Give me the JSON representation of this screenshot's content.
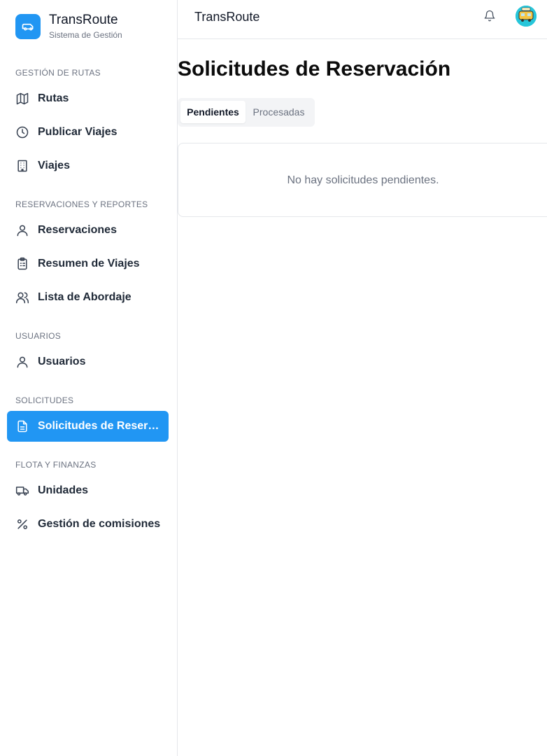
{
  "brand": {
    "title": "TransRoute",
    "subtitle": "Sistema de Gestión",
    "accent": "#2196f3"
  },
  "sidebar": {
    "sections": [
      {
        "label": "GESTIÓN DE RUTAS",
        "items": [
          {
            "label": "Rutas",
            "icon": "map-icon"
          },
          {
            "label": "Publicar Viajes",
            "icon": "clock-icon"
          },
          {
            "label": "Viajes",
            "icon": "building-icon"
          }
        ]
      },
      {
        "label": "RESERVACIONES Y REPORTES",
        "items": [
          {
            "label": "Reservaciones",
            "icon": "user-icon"
          },
          {
            "label": "Resumen de Viajes",
            "icon": "clipboard-list-icon"
          },
          {
            "label": "Lista de Abordaje",
            "icon": "users-icon"
          }
        ]
      },
      {
        "label": "USUARIOS",
        "items": [
          {
            "label": "Usuarios",
            "icon": "user-icon"
          }
        ]
      },
      {
        "label": "SOLICITUDES",
        "items": [
          {
            "label": "Solicitudes de Reservación",
            "icon": "file-text-icon",
            "active": true
          }
        ]
      },
      {
        "label": "FLOTA Y FINANZAS",
        "items": [
          {
            "label": "Unidades",
            "icon": "truck-icon"
          },
          {
            "label": "Gestión de comisiones",
            "icon": "percent-icon"
          }
        ]
      }
    ]
  },
  "header": {
    "title": "TransRoute",
    "notification_icon": "bell-icon",
    "avatar_icon": "avatar-icon"
  },
  "main": {
    "title": "Solicitudes de Reservación",
    "tabs": [
      {
        "label": "Pendientes",
        "active": true
      },
      {
        "label": "Procesadas",
        "active": false
      }
    ],
    "empty_message": "No hay solicitudes pendientes."
  }
}
